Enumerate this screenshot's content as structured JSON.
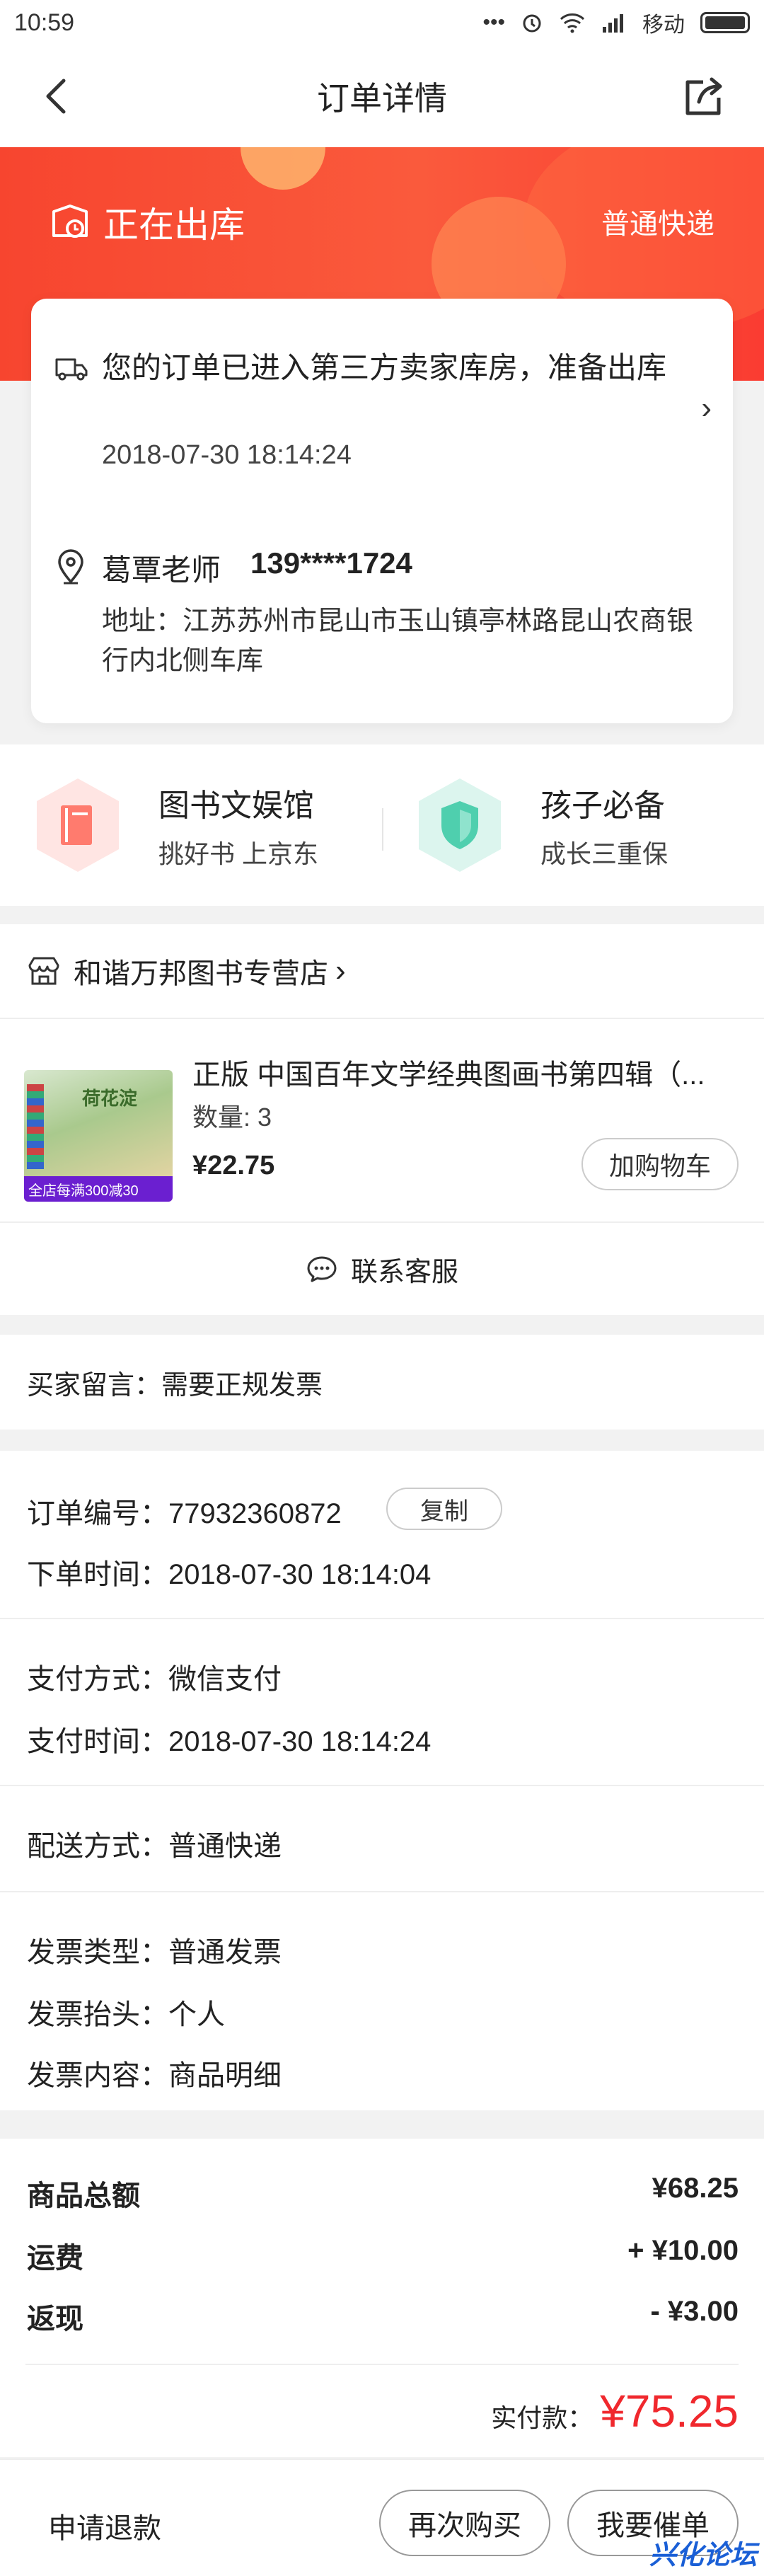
{
  "status_bar": {
    "time": "10:59",
    "dots": "•••",
    "carrier": "移动"
  },
  "nav": {
    "title": "订单详情"
  },
  "hero": {
    "status": "正在出库",
    "delivery": "普通快递"
  },
  "shipping": {
    "message": "您的订单已进入第三方卖家库房，准备出库",
    "time": "2018-07-30 18:14:24",
    "chevron": "›"
  },
  "address": {
    "name": "葛覃老师",
    "phone": "139****1724",
    "detail": "地址：江苏苏州市昆山市玉山镇亭林路昆山农商银行内北侧车库"
  },
  "promos": [
    {
      "title": "图书文娱馆",
      "subtitle": "挑好书 上京东",
      "icon": "book-icon"
    },
    {
      "title": "孩子必备",
      "subtitle": "成长三重保",
      "icon": "shield-icon"
    }
  ],
  "store": {
    "name": "和谐万邦图书专营店",
    "chevron": "›"
  },
  "product": {
    "title": "正版 中国百年文学经典图画书第四辑（...",
    "quantity": "数量: 3",
    "price": "¥22.75",
    "add_cart": "加购物车",
    "cover_title": "荷花淀",
    "cover_band": "全店每满300减30"
  },
  "service": {
    "label": "联系客服"
  },
  "remark": "买家留言：需要正规发票",
  "order_info": {
    "order_no": "订单编号：77932360872",
    "copy": "复制",
    "order_time": "下单时间：2018-07-30 18:14:04",
    "pay_method": "支付方式：微信支付",
    "pay_time": "支付时间：2018-07-30 18:14:24",
    "delivery_method": "配送方式：普通快递",
    "invoice_type": "发票类型：普通发票",
    "invoice_title": "发票抬头：个人",
    "invoice_content": "发票内容：商品明细"
  },
  "totals": {
    "goods_label": "商品总额",
    "goods_value": "¥68.25",
    "freight_label": "运费",
    "freight_value": "+ ¥10.00",
    "cashback_label": "返现",
    "cashback_value": "- ¥3.00",
    "paid_label": "实付款：",
    "paid_value": "¥75.25"
  },
  "bottom": {
    "refund": "申请退款",
    "rebuy": "再次购买",
    "urge": "我要催单"
  },
  "watermark": "兴化论坛",
  "colors": {
    "accent": "#f0282d",
    "hero": "#f7452f",
    "watermark": "#1a5fd6"
  }
}
